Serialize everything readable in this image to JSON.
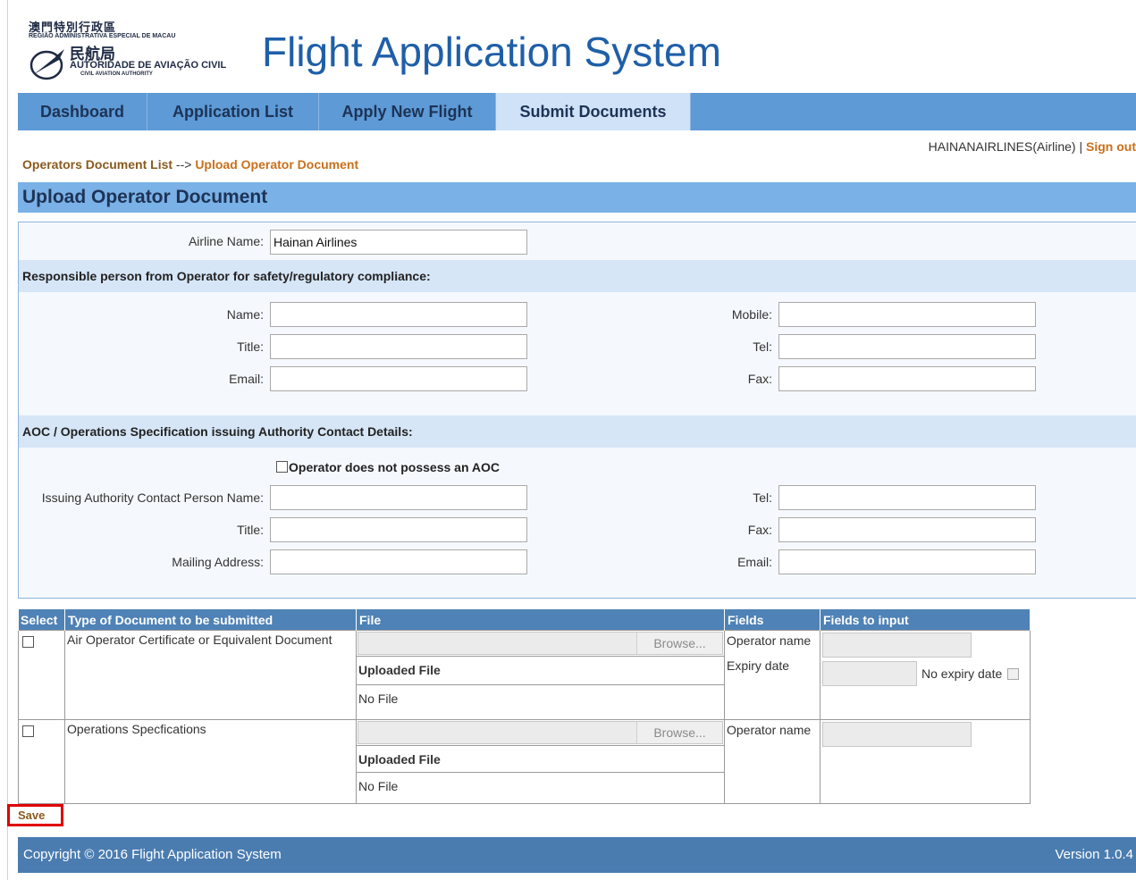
{
  "logo": {
    "line1": "澳門特別行政區",
    "line2": "REGIÃO ADMINISTRATIVA ESPECIAL DE MACAU",
    "line3": "民航局",
    "line4": "AUTORIDADE DE AVIAÇÃO CIVIL",
    "line5": "CIVIL AVIATION AUTHORITY"
  },
  "app_title": "Flight Application System",
  "nav": {
    "tabs": [
      {
        "label": "Dashboard"
      },
      {
        "label": "Application List"
      },
      {
        "label": "Apply New Flight"
      },
      {
        "label": "Submit Documents"
      }
    ]
  },
  "user": {
    "name": "HAINANAIRLINES(Airline)",
    "separator": " | ",
    "signout": "Sign out"
  },
  "breadcrumb": {
    "parent": "Operators Document List",
    "arrow": " --> ",
    "current": "Upload Operator Document"
  },
  "section_title": "Upload Operator Document",
  "form": {
    "airline_label": "Airline Name:",
    "airline_value": "Hainan Airlines",
    "responsible_heading": "Responsible person from Operator for safety/regulatory compliance:",
    "name_label": "Name:",
    "title_label": "Title:",
    "email_label": "Email:",
    "mobile_label": "Mobile:",
    "tel_label": "Tel:",
    "fax_label": "Fax:",
    "aoc_heading": "AOC / Operations Specification issuing Authority Contact Details:",
    "no_aoc_label": "Operator does not possess an AOC",
    "contact_name_label": "Issuing Authority Contact Person Name:",
    "aoc_title_label": "Title:",
    "mailing_label": "Mailing Address:",
    "aoc_tel_label": "Tel:",
    "aoc_fax_label": "Fax:",
    "aoc_email_label": "Email:"
  },
  "table": {
    "headers": [
      "Select",
      "Type of Document to be submitted",
      "File",
      "Fields",
      "Fields to input"
    ],
    "rows": [
      {
        "type": "Air Operator Certificate or Equivalent Document",
        "browse": "Browse...",
        "uploaded_label": "Uploaded File",
        "file": "No File",
        "field1": "Operator name",
        "field2": "Expiry date",
        "no_expiry": "No expiry date"
      },
      {
        "type": "Operations Specfications",
        "browse": "Browse...",
        "uploaded_label": "Uploaded File",
        "file": "No File",
        "field1": "Operator name"
      }
    ]
  },
  "save_label": "Save",
  "footer": {
    "copyright": "Copyright © 2016 Flight Application System",
    "version": "Version 1.0.4"
  }
}
